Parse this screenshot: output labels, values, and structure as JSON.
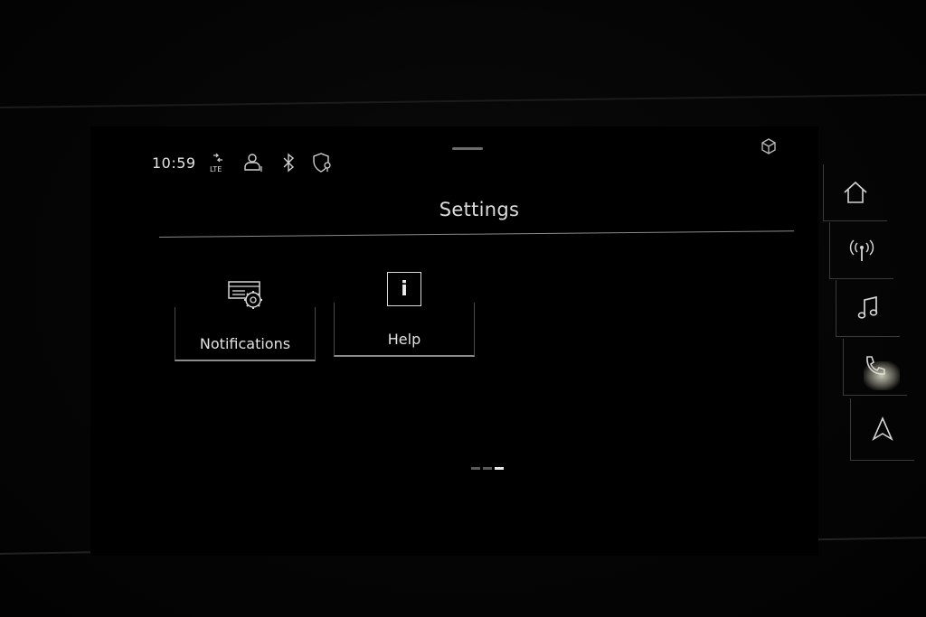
{
  "status_bar": {
    "time": "10:59",
    "network_label": "LTE",
    "icons": [
      "lte-signal-icon",
      "user-profile-icon",
      "bluetooth-icon",
      "location-shield-icon"
    ]
  },
  "header": {
    "title": "Settings"
  },
  "tiles": [
    {
      "label": "Notifications",
      "icon": "notifications-settings-icon"
    },
    {
      "label": "Help",
      "icon": "info-icon",
      "icon_glyph": "i"
    }
  ],
  "pager": {
    "pages": 3,
    "active": 3
  },
  "shortcuts": [
    {
      "name": "home",
      "icon": "home-icon"
    },
    {
      "name": "radio",
      "icon": "radio-icon"
    },
    {
      "name": "music",
      "icon": "music-note-icon"
    },
    {
      "name": "phone",
      "icon": "phone-icon"
    },
    {
      "name": "navigation",
      "icon": "navigation-arrow-icon"
    }
  ],
  "colors": {
    "background": "#000000",
    "text": "#e0e0e0",
    "divider": "#8a8a8a"
  }
}
